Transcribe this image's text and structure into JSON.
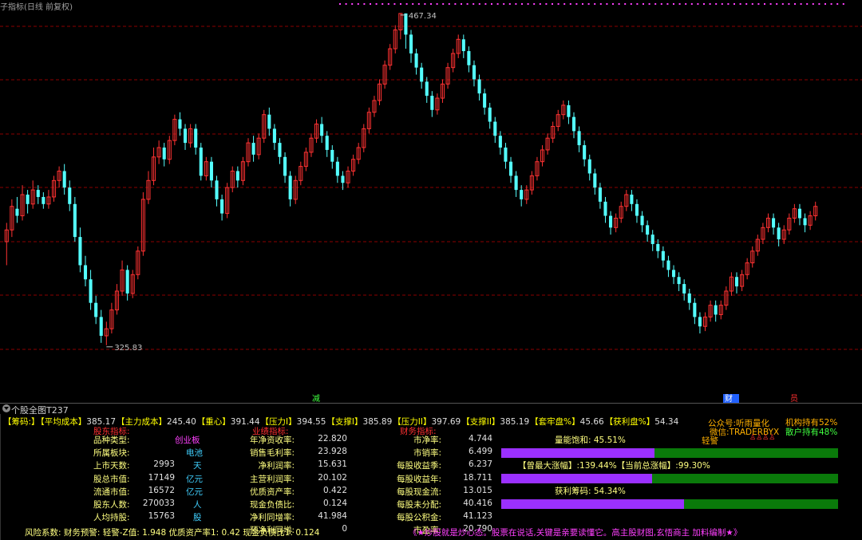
{
  "window": {
    "title": "个股全图T237"
  },
  "top_title": "子指标(日线 前复权)",
  "chart_data": {
    "type": "candlestick",
    "high_label": "467.34",
    "low_label": "325.83",
    "ylim": [
      310,
      470
    ],
    "grid": true,
    "colors": {
      "up": "#ff3232",
      "down": "#54ffff",
      "grid": "#8b0000"
    },
    "markers": [
      "减",
      "财",
      "员"
    ],
    "candles": [
      [
        370,
        375,
        378,
        360
      ],
      [
        375,
        385,
        388,
        372
      ],
      [
        384,
        381,
        389,
        378
      ],
      [
        381,
        390,
        394,
        379
      ],
      [
        390,
        386,
        392,
        382
      ],
      [
        386,
        392,
        396,
        384
      ],
      [
        392,
        389,
        394,
        386
      ],
      [
        389,
        386,
        391,
        384
      ],
      [
        386,
        389,
        392,
        384
      ],
      [
        389,
        396,
        398,
        387
      ],
      [
        396,
        400,
        402,
        393
      ],
      [
        400,
        393,
        403,
        390
      ],
      [
        393,
        386,
        396,
        383
      ],
      [
        386,
        372,
        389,
        370
      ],
      [
        372,
        360,
        376,
        357
      ],
      [
        360,
        354,
        364,
        351
      ],
      [
        354,
        344,
        358,
        341
      ],
      [
        344,
        338,
        347,
        335
      ],
      [
        338,
        330,
        341,
        327
      ],
      [
        330,
        333,
        336,
        326
      ],
      [
        333,
        341,
        344,
        331
      ],
      [
        341,
        349,
        352,
        339
      ],
      [
        349,
        358,
        362,
        347
      ],
      [
        358,
        348,
        360,
        345
      ],
      [
        348,
        356,
        358,
        346
      ],
      [
        356,
        366,
        368,
        354
      ],
      [
        366,
        388,
        391,
        364
      ],
      [
        388,
        396,
        400,
        386
      ],
      [
        396,
        406,
        410,
        394
      ],
      [
        406,
        410,
        413,
        403
      ],
      [
        410,
        405,
        412,
        402
      ],
      [
        405,
        413,
        415,
        403
      ],
      [
        413,
        422,
        424,
        411
      ],
      [
        422,
        418,
        425,
        415
      ],
      [
        418,
        412,
        420,
        409
      ],
      [
        412,
        418,
        420,
        410
      ],
      [
        418,
        410,
        420,
        407
      ],
      [
        410,
        398,
        412,
        396
      ],
      [
        398,
        404,
        406,
        396
      ],
      [
        404,
        396,
        406,
        393
      ],
      [
        396,
        388,
        398,
        385
      ],
      [
        388,
        382,
        390,
        379
      ],
      [
        382,
        393,
        395,
        380
      ],
      [
        393,
        400,
        402,
        391
      ],
      [
        400,
        396,
        402,
        393
      ],
      [
        396,
        404,
        406,
        394
      ],
      [
        404,
        412,
        414,
        402
      ],
      [
        412,
        407,
        415,
        404
      ],
      [
        407,
        414,
        416,
        405
      ],
      [
        414,
        424,
        426,
        412
      ],
      [
        424,
        418,
        427,
        415
      ],
      [
        418,
        412,
        420,
        409
      ],
      [
        412,
        406,
        414,
        403
      ],
      [
        406,
        398,
        408,
        395
      ],
      [
        398,
        388,
        400,
        385
      ],
      [
        388,
        396,
        398,
        386
      ],
      [
        396,
        402,
        404,
        394
      ],
      [
        402,
        408,
        410,
        400
      ],
      [
        408,
        414,
        416,
        406
      ],
      [
        414,
        420,
        422,
        412
      ],
      [
        420,
        415,
        423,
        412
      ],
      [
        415,
        409,
        417,
        406
      ],
      [
        409,
        404,
        411,
        401
      ],
      [
        404,
        398,
        406,
        395
      ],
      [
        398,
        395,
        400,
        392
      ],
      [
        395,
        400,
        402,
        393
      ],
      [
        400,
        405,
        407,
        398
      ],
      [
        405,
        410,
        412,
        403
      ],
      [
        410,
        418,
        420,
        408
      ],
      [
        418,
        425,
        427,
        416
      ],
      [
        425,
        430,
        432,
        423
      ],
      [
        430,
        437,
        439,
        428
      ],
      [
        437,
        445,
        447,
        435
      ],
      [
        445,
        452,
        454,
        443
      ],
      [
        452,
        460,
        462,
        450
      ],
      [
        460,
        467,
        467,
        456
      ],
      [
        467,
        458,
        467,
        452
      ],
      [
        458,
        450,
        460,
        446
      ],
      [
        450,
        444,
        452,
        441
      ],
      [
        444,
        438,
        446,
        435
      ],
      [
        438,
        432,
        440,
        429
      ],
      [
        432,
        426,
        434,
        423
      ],
      [
        426,
        431,
        433,
        424
      ],
      [
        431,
        437,
        439,
        429
      ],
      [
        437,
        444,
        446,
        435
      ],
      [
        444,
        450,
        452,
        442
      ],
      [
        450,
        456,
        458,
        448
      ],
      [
        456,
        451,
        458,
        448
      ],
      [
        451,
        445,
        453,
        442
      ],
      [
        445,
        439,
        447,
        436
      ],
      [
        439,
        433,
        441,
        430
      ],
      [
        433,
        427,
        435,
        424
      ],
      [
        427,
        421,
        429,
        418
      ],
      [
        421,
        415,
        423,
        412
      ],
      [
        415,
        410,
        417,
        407
      ],
      [
        410,
        404,
        412,
        401
      ],
      [
        404,
        398,
        406,
        395
      ],
      [
        398,
        392,
        400,
        389
      ],
      [
        392,
        388,
        394,
        385
      ],
      [
        388,
        392,
        394,
        386
      ],
      [
        392,
        398,
        400,
        390
      ],
      [
        398,
        404,
        406,
        396
      ],
      [
        404,
        409,
        411,
        402
      ],
      [
        409,
        414,
        416,
        407
      ],
      [
        414,
        419,
        421,
        412
      ],
      [
        419,
        424,
        426,
        417
      ],
      [
        424,
        428,
        430,
        422
      ],
      [
        428,
        423,
        430,
        420
      ],
      [
        423,
        417,
        425,
        414
      ],
      [
        417,
        411,
        419,
        408
      ],
      [
        411,
        405,
        413,
        402
      ],
      [
        405,
        399,
        407,
        396
      ],
      [
        399,
        393,
        401,
        390
      ],
      [
        393,
        387,
        395,
        384
      ],
      [
        387,
        381,
        389,
        378
      ],
      [
        381,
        376,
        383,
        373
      ],
      [
        376,
        380,
        382,
        374
      ],
      [
        380,
        385,
        387,
        378
      ],
      [
        385,
        390,
        392,
        383
      ],
      [
        390,
        386,
        392,
        383
      ],
      [
        386,
        381,
        388,
        378
      ],
      [
        381,
        377,
        383,
        374
      ],
      [
        377,
        373,
        379,
        370
      ],
      [
        373,
        369,
        375,
        366
      ],
      [
        369,
        366,
        371,
        363
      ],
      [
        366,
        362,
        368,
        359
      ],
      [
        362,
        358,
        364,
        355
      ],
      [
        358,
        355,
        360,
        352
      ],
      [
        355,
        352,
        357,
        349
      ],
      [
        352,
        348,
        354,
        345
      ],
      [
        348,
        344,
        350,
        341
      ],
      [
        344,
        338,
        346,
        335
      ],
      [
        338,
        334,
        340,
        331
      ],
      [
        334,
        338,
        340,
        332
      ],
      [
        338,
        343,
        345,
        336
      ],
      [
        343,
        339,
        345,
        336
      ],
      [
        339,
        343,
        345,
        337
      ],
      [
        343,
        349,
        351,
        341
      ],
      [
        349,
        355,
        357,
        347
      ],
      [
        355,
        351,
        357,
        348
      ],
      [
        351,
        356,
        358,
        349
      ],
      [
        356,
        361,
        363,
        354
      ],
      [
        361,
        366,
        368,
        359
      ],
      [
        366,
        371,
        373,
        364
      ],
      [
        371,
        376,
        378,
        369
      ],
      [
        376,
        380,
        382,
        374
      ],
      [
        380,
        376,
        382,
        373
      ],
      [
        376,
        371,
        378,
        368
      ],
      [
        371,
        375,
        377,
        369
      ],
      [
        375,
        380,
        382,
        373
      ],
      [
        380,
        384,
        386,
        378
      ],
      [
        384,
        380,
        386,
        377
      ],
      [
        380,
        377,
        382,
        374
      ],
      [
        377,
        381,
        383,
        375
      ],
      [
        381,
        385,
        387,
        379
      ]
    ]
  },
  "panel": {
    "chip_items": [
      {
        "label": "【筹码:】",
        "value": ""
      },
      {
        "label": "【平均成本】",
        "value": "385.17"
      },
      {
        "label": "【主力成本】",
        "value": "245.40"
      },
      {
        "label": "【重心】",
        "value": "391.44"
      },
      {
        "label": "【压力I】",
        "value": "394.55"
      },
      {
        "label": "【支撑I】",
        "value": "385.89"
      },
      {
        "label": "【压力II】",
        "value": "397.69"
      },
      {
        "label": "【支撑II】",
        "value": "385.19"
      },
      {
        "label": "【套牢盘%】",
        "value": "45.66"
      },
      {
        "label": "【获利盘%】",
        "value": "54.34"
      }
    ],
    "headers": {
      "shareholder": "股东指标:",
      "performance": "业绩指标:",
      "financial": "财务指标:"
    },
    "col1": [
      {
        "label": "品种类型:",
        "value": "创业板",
        "unit": ""
      },
      {
        "label": "所属板块:",
        "value": "电池",
        "unit": ""
      },
      {
        "label": "上市天数:",
        "value": "2993",
        "unit": "天"
      },
      {
        "label": "股总市值:",
        "value": "17149",
        "unit": "亿元"
      },
      {
        "label": "流通市值:",
        "value": "16572",
        "unit": "亿元"
      },
      {
        "label": "股东人数:",
        "value": "270033",
        "unit": "人"
      },
      {
        "label": "人均持股:",
        "value": "15763",
        "unit": "股"
      }
    ],
    "col2": [
      {
        "label": "年净资收率:",
        "value": "22.820"
      },
      {
        "label": "销售毛利率:",
        "value": "23.928"
      },
      {
        "label": "净利润率:",
        "value": "15.631"
      },
      {
        "label": "主营利润率:",
        "value": "20.102"
      },
      {
        "label": "优质资产率:",
        "value": "0.422"
      },
      {
        "label": "现金负债比:",
        "value": "0.124"
      },
      {
        "label": "净利同增率:",
        "value": "41.984"
      },
      {
        "label": "预净利同增:",
        "value": "0"
      }
    ],
    "col3": [
      {
        "label": "市净率:",
        "value": "4.744"
      },
      {
        "label": "市销率:",
        "value": "6.499"
      },
      {
        "label": "每股收益季:",
        "value": "6.237"
      },
      {
        "label": "每股收益年:",
        "value": "18.711"
      },
      {
        "label": "每股现金流:",
        "value": "13.015"
      },
      {
        "label": "每股未分配:",
        "value": "40.416"
      },
      {
        "label": "每股公积金:",
        "value": "41.123"
      },
      {
        "label": "市盈率:",
        "value": "20.790"
      }
    ],
    "right": {
      "public_account": "公众号:听雨量化",
      "wechat": "微信:TRADERBYX",
      "inst_hold": "机构持有52%",
      "retail_hold": "散户持有48%",
      "light_warn": "轻警",
      "vol_sat_text": "量能饱和: 45.51%",
      "vol_sat_pct": 45.51,
      "rise_text": "【曾最大涨幅】:139.44%【当前总涨幅】:99.30%",
      "rise_pct": 99.3,
      "profit_text": "获利筹码: 54.34%",
      "profit_pct": 54.34
    },
    "bottom_line": "风险系数: 财务预警: 轻警-Z值: 1.948 优质资产率1: 0.42 现金负债比1: 0.124",
    "slogan": "《★炒股就是炒心态。股票在说话,关键是亲要读懂它。高主股财图,玄悟商主 加料编制★》"
  }
}
